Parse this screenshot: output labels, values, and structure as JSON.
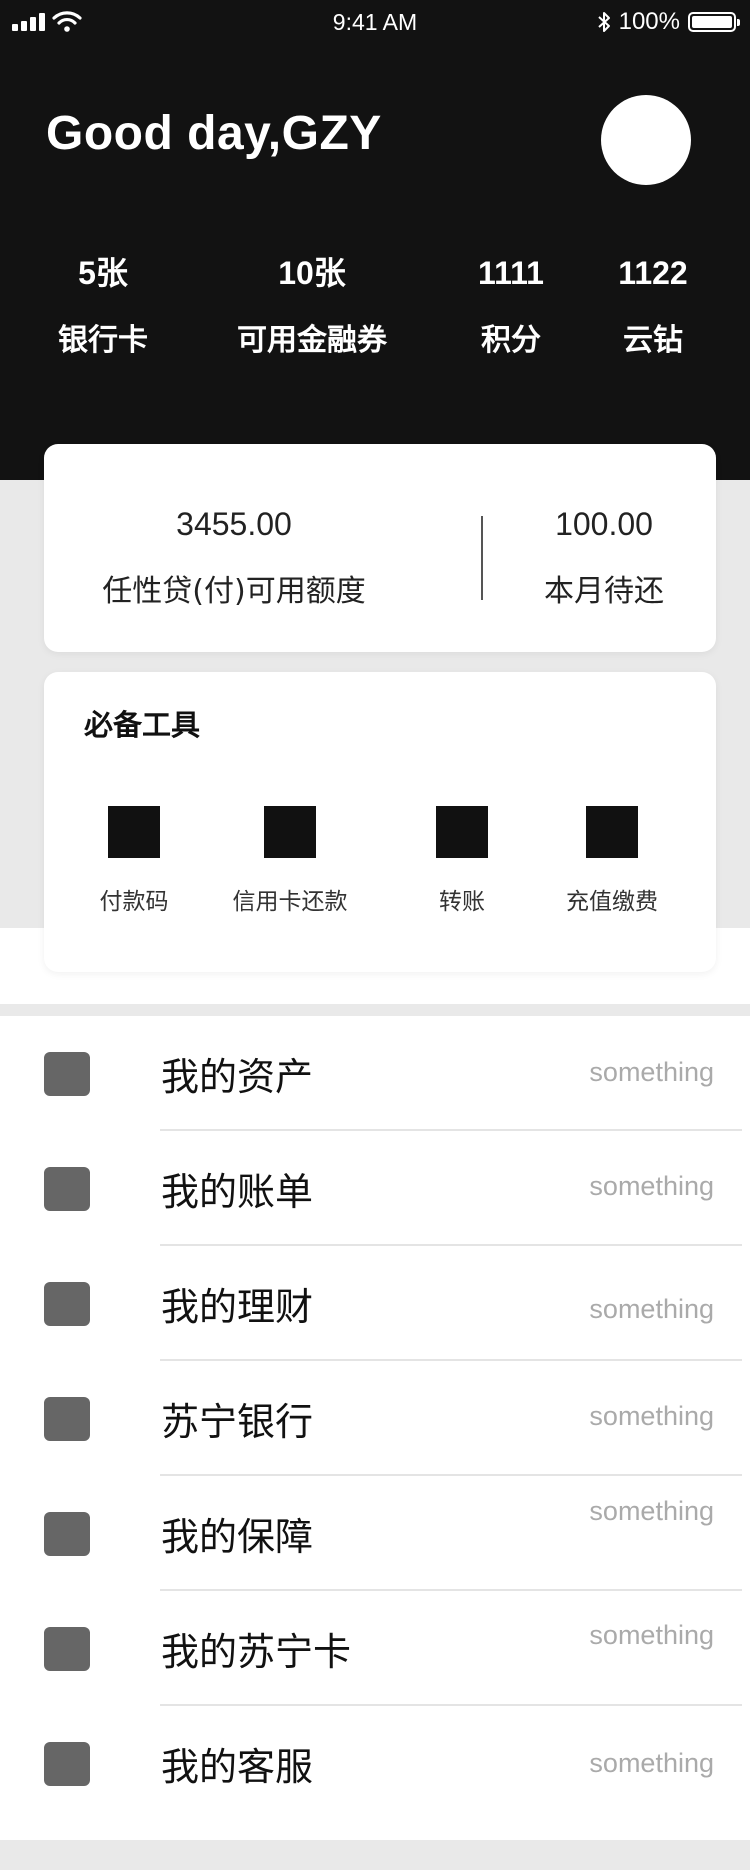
{
  "status_bar": {
    "time": "9:41 AM",
    "battery": "100%"
  },
  "header": {
    "greeting": "Good day,GZY",
    "stats": [
      {
        "value": "5张",
        "label": "银行卡"
      },
      {
        "value": "10张",
        "label": "可用金融券"
      },
      {
        "value": "1111",
        "label": "积分"
      },
      {
        "value": "1122",
        "label": "云钻"
      }
    ]
  },
  "credit": {
    "available_amount": "3455.00",
    "available_label": "任性贷(付)可用额度",
    "due_amount": "100.00",
    "due_label": "本月待还"
  },
  "tools": {
    "title": "必备工具",
    "items": [
      {
        "label": "付款码"
      },
      {
        "label": "信用卡还款"
      },
      {
        "label": "转账"
      },
      {
        "label": "充值缴费"
      }
    ]
  },
  "menu": [
    {
      "title": "我的资产",
      "value": "something"
    },
    {
      "title": "我的账单",
      "value": "something"
    },
    {
      "title": "我的理财",
      "value": "something"
    },
    {
      "title": "苏宁银行",
      "value": "something"
    },
    {
      "title": "我的保障",
      "value": "something"
    },
    {
      "title": "我的苏宁卡",
      "value": "something"
    },
    {
      "title": "我的客服",
      "value": "something"
    }
  ],
  "colors": {
    "header_bg": "#121212",
    "icon_gray": "#666666",
    "muted_text": "#aaaaaa"
  }
}
